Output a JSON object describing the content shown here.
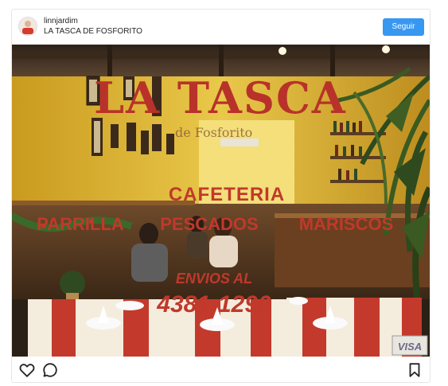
{
  "post": {
    "username": "linnjardim",
    "location": "LA TASCA DE FOSFORITO",
    "follow_label": "Seguir",
    "accent_color": "#3897f0"
  },
  "photo": {
    "sign_title": "LA TASCA",
    "sign_subtitle": "de Fosforito",
    "line_cafeteria": "CAFETERIA",
    "line_parrilla": "PARRILLA",
    "line_pescados": "PESCADOS",
    "line_mariscos": "MARISCOS",
    "line_envios": "ENVIOS AL",
    "phone": "4381-1290",
    "visa": "VISA",
    "lettering_color": "#c0392b"
  },
  "actions": {
    "like_icon": "heart-outline-icon",
    "comment_icon": "comment-bubble-icon",
    "save_icon": "bookmark-outline-icon"
  }
}
